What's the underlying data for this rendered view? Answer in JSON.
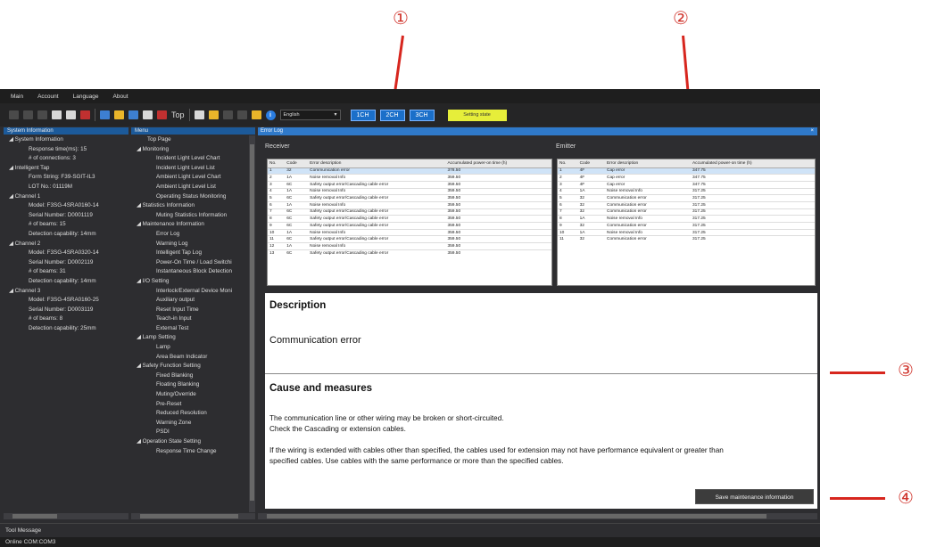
{
  "menu": [
    "Main",
    "Account",
    "Language",
    "About"
  ],
  "toolbar": {
    "top": "Top",
    "language": "English",
    "ch1": "1CH",
    "ch2": "2CH",
    "ch3": "3CH",
    "setting_state": "Setting state"
  },
  "sysinfo": {
    "title": "System Information",
    "items": [
      "◢ System Information",
      "Response time(ms): 15",
      "# of connections: 3",
      "◢ Intelligent Tap",
      "Form String: F39-SGIT-IL3",
      "LOT No.: 01119M",
      "◢ Channel 1",
      "Model: F3SG-4SRA0160-14",
      "Serial Number: D0001119",
      "# of beams: 15",
      "Detection capability: 14mm",
      "◢ Channel 2",
      "Model: F3SG-4SRA0320-14",
      "Serial Number: D0002119",
      "# of beams: 31",
      "Detection capability: 14mm",
      "◢ Channel 3",
      "Model: F3SG-4SRA0160-25",
      "Serial Number: D0003119",
      "# of beams: 8",
      "Detection capability: 25mm"
    ]
  },
  "menu_panel": {
    "title": "Menu",
    "items": [
      "Top Page",
      "◢ Monitoring",
      "Incident Light Level Chart",
      "Incident Light Level List",
      "Ambient Light Level Chart",
      "Ambient Light Level List",
      "Operating Status Monitoring",
      "◢ Statistics Information",
      "Muting Statistics Information",
      "◢ Maintenance Information",
      "Error Log",
      "Warning Log",
      "Intelligent Tap Log",
      "Power-On Time / Load Switchi",
      "Instantaneous Block Detection",
      "◢ I/O Setting",
      "Interlock/External Device Moni",
      "Auxiliary output",
      "Reset Input Time",
      "Teach-in Input",
      "External Test",
      "◢ Lamp Setting",
      "Lamp",
      "Area Beam Indicator",
      "◢ Safety Function Setting",
      "Fixed Blanking",
      "Floating Blanking",
      "Muting/Override",
      "Pre-Reset",
      "Reduced Resolution",
      "Warning Zone",
      "PSDI",
      "◢ Operation State Setting",
      "Response Time Change"
    ]
  },
  "errlog": {
    "title": "Error Log",
    "receiver_label": "Receiver",
    "emitter_label": "Emitter",
    "receiver_cols": [
      "No.",
      "Code",
      "Error description",
      "Accumulated power-on time (h)"
    ],
    "emitter_cols": [
      "No.",
      "Code",
      "Error description",
      "Accumulated power-on time (h)"
    ],
    "receiver_rows": [
      [
        "1",
        "32",
        "Communication error",
        "378.50"
      ],
      [
        "2",
        "1A",
        "Noise removal Info",
        "359.50"
      ],
      [
        "3",
        "6C",
        "Safety output error/Cascading cable error",
        "359.50"
      ],
      [
        "4",
        "1A",
        "Noise removal Info",
        "359.50"
      ],
      [
        "5",
        "6C",
        "Safety output error/Cascading cable error",
        "359.50"
      ],
      [
        "6",
        "1A",
        "Noise removal Info",
        "359.50"
      ],
      [
        "7",
        "6C",
        "Safety output error/Cascading cable error",
        "359.50"
      ],
      [
        "8",
        "6C",
        "Safety output error/Cascading cable error",
        "359.50"
      ],
      [
        "9",
        "6C",
        "Safety output error/Cascading cable error",
        "359.50"
      ],
      [
        "10",
        "1A",
        "Noise removal Info",
        "359.50"
      ],
      [
        "11",
        "6C",
        "Safety output error/Cascading cable error",
        "359.50"
      ],
      [
        "12",
        "1A",
        "Noise removal Info",
        "359.50"
      ],
      [
        "13",
        "6C",
        "Safety output error/Cascading cable error",
        "359.50"
      ]
    ],
    "emitter_rows": [
      [
        "1",
        "4F",
        "Cap error",
        "347.75"
      ],
      [
        "2",
        "4F",
        "Cap error",
        "347.75"
      ],
      [
        "3",
        "4F",
        "Cap error",
        "347.75"
      ],
      [
        "4",
        "1A",
        "Noise removal Info",
        "317.25"
      ],
      [
        "5",
        "32",
        "Communication error",
        "317.25"
      ],
      [
        "6",
        "32",
        "Communication error",
        "317.25"
      ],
      [
        "7",
        "32",
        "Communication error",
        "317.25"
      ],
      [
        "8",
        "1A",
        "Noise removal Info",
        "317.25"
      ],
      [
        "9",
        "32",
        "Communication error",
        "317.25"
      ],
      [
        "10",
        "1A",
        "Noise removal Info",
        "317.25"
      ],
      [
        "11",
        "32",
        "Communication error",
        "317.25"
      ]
    ],
    "description_heading": "Description",
    "description_text": "Communication error",
    "cause_heading": "Cause and measures",
    "cause_p1a": "The communication line or other wiring may be broken or short-circuited.",
    "cause_p1b": "Check the Cascading or extension cables.",
    "cause_p2a": "If the wiring is extended with cables other than specified, the cables used for extension may not have performance equivalent or greater than",
    "cause_p2b": "specified cables. Use cables with the same performance or more than the specified cables.",
    "save_button": "Save maintenance information"
  },
  "bottom": {
    "tool_message": "Tool Message",
    "status": "Online    COM:COM3"
  },
  "callouts": [
    "①",
    "②",
    "③",
    "④"
  ],
  "colors": {
    "accent": "#1b6fc9",
    "callout": "#d0342c",
    "setting_state": "#e6ee3a"
  }
}
